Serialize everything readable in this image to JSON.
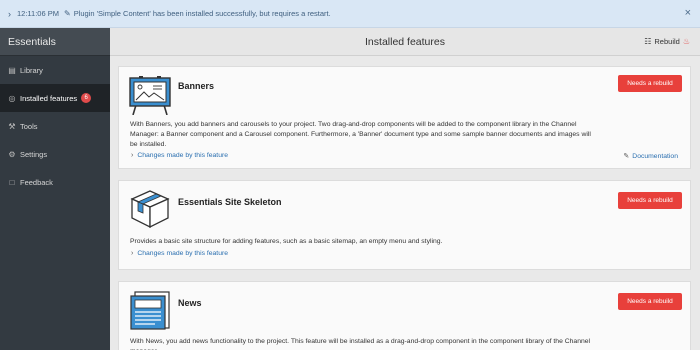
{
  "notification": {
    "time": "12:11:06 PM",
    "message": "Plugin 'Simple Content' has been installed successfully, but requires a restart."
  },
  "sidebar": {
    "title": "Essentials",
    "items": [
      {
        "label": "Library",
        "icon": "library-icon"
      },
      {
        "label": "Installed features",
        "icon": "installed-features-icon",
        "badge": "6"
      },
      {
        "label": "Tools",
        "icon": "wrench-icon"
      },
      {
        "label": "Settings",
        "icon": "gear-icon"
      },
      {
        "label": "Feedback",
        "icon": "chat-icon"
      }
    ]
  },
  "topbar": {
    "title": "Installed features",
    "rebuild_label": "Rebuild"
  },
  "features": [
    {
      "name": "Banners",
      "button_label": "Needs a rebuild",
      "description": "With Banners, you add banners and carousels to your project. Two drag-and-drop components will be added to the component library in the Channel Manager: a Banner component and a Carousel component. Furthermore, a 'Banner' document type and some sample banner documents and images will be installed.",
      "changes_label": "Changes made by this feature",
      "doc_label": "Documentation"
    },
    {
      "name": "Essentials Site Skeleton",
      "button_label": "Needs a rebuild",
      "description": "Provides a basic site structure for adding features, such as a basic sitemap, an empty menu and styling.",
      "changes_label": "Changes made by this feature"
    },
    {
      "name": "News",
      "button_label": "Needs a rebuild",
      "description": "With News, you add news functionality to the project. This feature will be installed as a drag-and-drop component in the component library of the Channel manager."
    }
  ],
  "colors": {
    "accent_red": "#e8403b",
    "link_blue": "#2a6fb0",
    "sidebar_bg": "#333a41",
    "icon_blue": "#3a8fd0"
  }
}
